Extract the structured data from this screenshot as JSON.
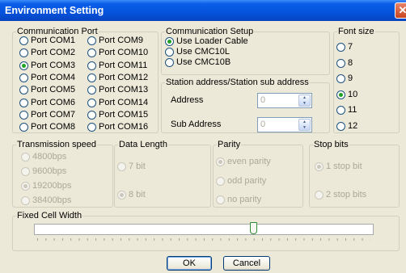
{
  "window": {
    "title": "Environment Setting",
    "close_glyph": "✕"
  },
  "communication_port": {
    "legend": "Communication Port",
    "ports": [
      {
        "label": "Port COM1",
        "selected": false
      },
      {
        "label": "Port COM2",
        "selected": false
      },
      {
        "label": "Port COM3",
        "selected": true
      },
      {
        "label": "Port COM4",
        "selected": false
      },
      {
        "label": "Port COM5",
        "selected": false
      },
      {
        "label": "Port COM6",
        "selected": false
      },
      {
        "label": "Port COM7",
        "selected": false
      },
      {
        "label": "Port COM8",
        "selected": false
      },
      {
        "label": "Port COM9",
        "selected": false
      },
      {
        "label": "Port COM10",
        "selected": false
      },
      {
        "label": "Port COM11",
        "selected": false
      },
      {
        "label": "Port COM12",
        "selected": false
      },
      {
        "label": "Port COM13",
        "selected": false
      },
      {
        "label": "Port COM14",
        "selected": false
      },
      {
        "label": "Port COM15",
        "selected": false
      },
      {
        "label": "Port COM16",
        "selected": false
      }
    ]
  },
  "communication_setup": {
    "legend": "Communication Setup",
    "options": [
      {
        "label": "Use Loader Cable",
        "selected": true
      },
      {
        "label": "Use CMC10L",
        "selected": false
      },
      {
        "label": "Use CMC10B",
        "selected": false
      }
    ]
  },
  "station": {
    "legend": "Station address/Station sub address",
    "address_label": "Address",
    "address_value": "0",
    "sub_address_label": "Sub Address",
    "sub_address_value": "0"
  },
  "font_size": {
    "legend": "Font size",
    "options": [
      {
        "label": "7",
        "selected": false
      },
      {
        "label": "8",
        "selected": false
      },
      {
        "label": "9",
        "selected": false
      },
      {
        "label": "10",
        "selected": true
      },
      {
        "label": "11",
        "selected": false
      },
      {
        "label": "12",
        "selected": false
      }
    ]
  },
  "transmission_speed": {
    "legend": "Transmission speed",
    "options": [
      {
        "label": "4800bps",
        "selected": false
      },
      {
        "label": "9600bps",
        "selected": false
      },
      {
        "label": "19200bps",
        "selected": true
      },
      {
        "label": "38400bps",
        "selected": false
      }
    ]
  },
  "data_length": {
    "legend": "Data Length",
    "options": [
      {
        "label": "7 bit",
        "selected": false
      },
      {
        "label": "8 bit",
        "selected": true
      }
    ]
  },
  "parity": {
    "legend": "Parity",
    "options": [
      {
        "label": "even parity",
        "selected": true
      },
      {
        "label": "odd  parity",
        "selected": false
      },
      {
        "label": "no parity",
        "selected": false
      }
    ]
  },
  "stop_bits": {
    "legend": "Stop bits",
    "options": [
      {
        "label": "1 stop bit",
        "selected": true
      },
      {
        "label": "2 stop bits",
        "selected": false
      }
    ]
  },
  "fixed_cell_width": {
    "legend": "Fixed Cell Width",
    "slider_level_fraction": 0.65
  },
  "buttons": {
    "ok": "OK",
    "cancel": "Cancel"
  },
  "colors": {
    "titlebar": "#0553dc",
    "window_bg": "#ece9d8",
    "radio_selected": "#21a121",
    "disabled_text": "#aca899"
  }
}
